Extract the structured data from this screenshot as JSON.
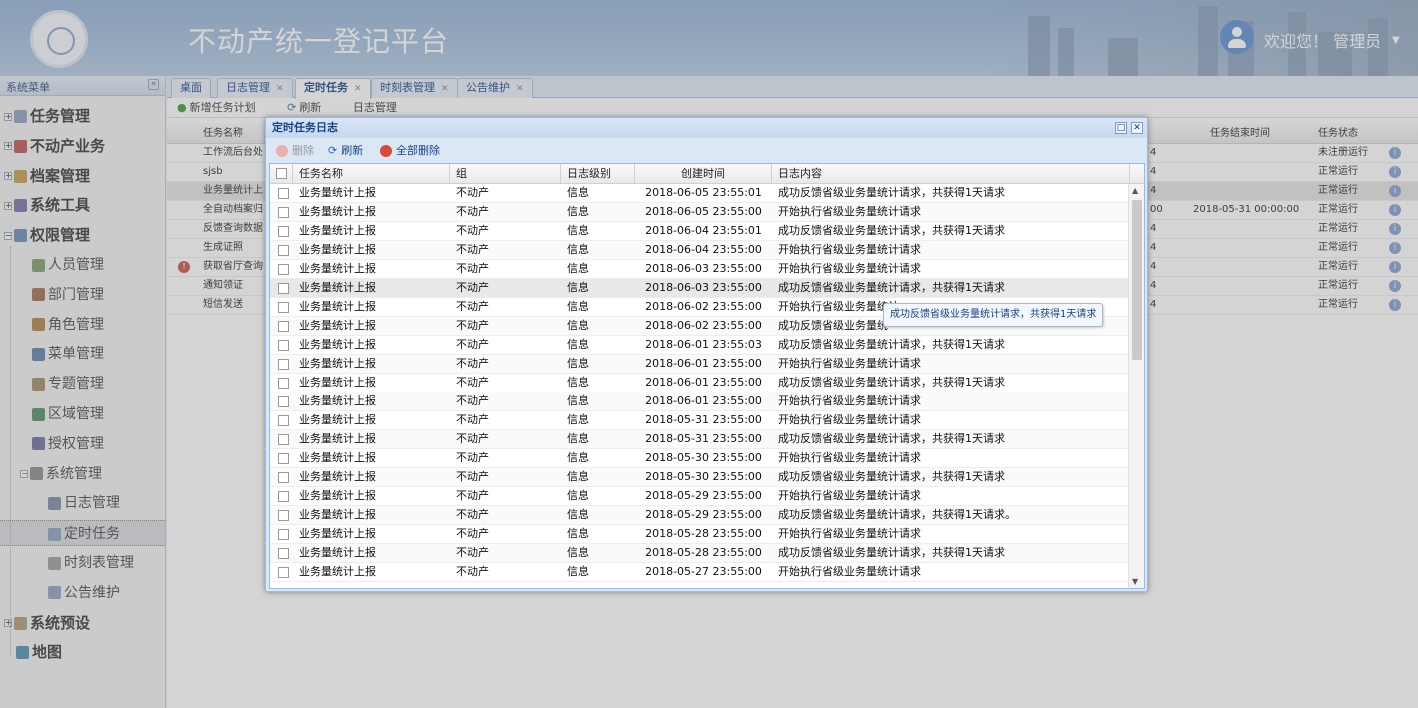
{
  "header": {
    "title": "不动产统一登记平台",
    "welcome": "欢迎您！ 管理员"
  },
  "sidebar": {
    "title": "系统菜单",
    "items": [
      {
        "label": "任务管理",
        "level": 1,
        "expand": "+"
      },
      {
        "label": "不动产业务",
        "level": 1,
        "expand": "+"
      },
      {
        "label": "档案管理",
        "level": 1,
        "expand": "+"
      },
      {
        "label": "系统工具",
        "level": 1,
        "expand": "+"
      },
      {
        "label": "权限管理",
        "level": 1,
        "expand": "-"
      },
      {
        "label": "人员管理",
        "level": 2
      },
      {
        "label": "部门管理",
        "level": 2
      },
      {
        "label": "角色管理",
        "level": 2
      },
      {
        "label": "菜单管理",
        "level": 2
      },
      {
        "label": "专题管理",
        "level": 2
      },
      {
        "label": "区域管理",
        "level": 2
      },
      {
        "label": "授权管理",
        "level": 2
      },
      {
        "label": "系统管理",
        "level": 2,
        "expand": "-"
      },
      {
        "label": "日志管理",
        "level": 3
      },
      {
        "label": "定时任务",
        "level": 3,
        "selected": true
      },
      {
        "label": "时刻表管理",
        "level": 3
      },
      {
        "label": "公告维护",
        "level": 3
      },
      {
        "label": "系统预设",
        "level": 1,
        "expand": "+"
      },
      {
        "label": "地图",
        "level": 1
      }
    ]
  },
  "tabs": [
    {
      "label": "桌面",
      "closable": false
    },
    {
      "label": "日志管理",
      "closable": true
    },
    {
      "label": "定时任务",
      "closable": true,
      "active": true
    },
    {
      "label": "时刻表管理",
      "closable": true
    },
    {
      "label": "公告维护",
      "closable": true
    }
  ],
  "main_toolbar": {
    "add": "新增任务计划",
    "refresh": "刷新",
    "log": "日志管理"
  },
  "bg_table": {
    "headers": {
      "name": "任务名称",
      "end": "任务结束时间",
      "status": "任务状态"
    },
    "rows": [
      {
        "name": "工作流后台处",
        "time": "4",
        "end": "",
        "status": "未注册运行"
      },
      {
        "name": "sjsb",
        "time": "4",
        "end": "",
        "status": "正常运行"
      },
      {
        "name": "业务量统计上",
        "time": "4",
        "end": "",
        "status": "正常运行"
      },
      {
        "name": "全自动档案归",
        "time": "00",
        "end": "2018-05-31 00:00:00",
        "status": "正常运行"
      },
      {
        "name": "反馈查询数据",
        "time": "4",
        "end": "",
        "status": "正常运行"
      },
      {
        "name": "生成证照",
        "time": "4",
        "end": "",
        "status": "正常运行"
      },
      {
        "name": "获取省厅查询",
        "time": "4",
        "end": "",
        "status": "正常运行"
      },
      {
        "name": "通知领证",
        "time": "4",
        "end": "",
        "status": "正常运行"
      },
      {
        "name": "短信发送",
        "time": "4",
        "end": "",
        "status": "正常运行"
      }
    ]
  },
  "dialog": {
    "title": "定时任务日志",
    "toolbar": {
      "delete": "删除",
      "refresh": "刷新",
      "delete_all": "全部删除"
    },
    "columns": {
      "name": "任务名称",
      "group": "组",
      "level": "日志级别",
      "created": "创建时间",
      "content": "日志内容"
    },
    "rows": [
      {
        "name": "业务量统计上报",
        "group": "不动产",
        "level": "信息",
        "created": "2018-06-05 23:55:01",
        "content": "成功反馈省级业务量统计请求，共获得1天请求"
      },
      {
        "name": "业务量统计上报",
        "group": "不动产",
        "level": "信息",
        "created": "2018-06-05 23:55:00",
        "content": "开始执行省级业务量统计请求"
      },
      {
        "name": "业务量统计上报",
        "group": "不动产",
        "level": "信息",
        "created": "2018-06-04 23:55:01",
        "content": "成功反馈省级业务量统计请求，共获得1天请求"
      },
      {
        "name": "业务量统计上报",
        "group": "不动产",
        "level": "信息",
        "created": "2018-06-04 23:55:00",
        "content": "开始执行省级业务量统计请求"
      },
      {
        "name": "业务量统计上报",
        "group": "不动产",
        "level": "信息",
        "created": "2018-06-03 23:55:00",
        "content": "开始执行省级业务量统计请求"
      },
      {
        "name": "业务量统计上报",
        "group": "不动产",
        "level": "信息",
        "created": "2018-06-03 23:55:00",
        "content": "成功反馈省级业务量统计请求，共获得1天请求"
      },
      {
        "name": "业务量统计上报",
        "group": "不动产",
        "level": "信息",
        "created": "2018-06-02 23:55:00",
        "content": "开始执行省级业务量统计"
      },
      {
        "name": "业务量统计上报",
        "group": "不动产",
        "level": "信息",
        "created": "2018-06-02 23:55:00",
        "content": "成功反馈省级业务量统"
      },
      {
        "name": "业务量统计上报",
        "group": "不动产",
        "level": "信息",
        "created": "2018-06-01 23:55:03",
        "content": "成功反馈省级业务量统计请求，共获得1天请求"
      },
      {
        "name": "业务量统计上报",
        "group": "不动产",
        "level": "信息",
        "created": "2018-06-01 23:55:00",
        "content": "开始执行省级业务量统计请求"
      },
      {
        "name": "业务量统计上报",
        "group": "不动产",
        "level": "信息",
        "created": "2018-06-01 23:55:00",
        "content": "成功反馈省级业务量统计请求，共获得1天请求"
      },
      {
        "name": "业务量统计上报",
        "group": "不动产",
        "level": "信息",
        "created": "2018-06-01 23:55:00",
        "content": "开始执行省级业务量统计请求"
      },
      {
        "name": "业务量统计上报",
        "group": "不动产",
        "level": "信息",
        "created": "2018-05-31 23:55:00",
        "content": "开始执行省级业务量统计请求"
      },
      {
        "name": "业务量统计上报",
        "group": "不动产",
        "level": "信息",
        "created": "2018-05-31 23:55:00",
        "content": "成功反馈省级业务量统计请求，共获得1天请求"
      },
      {
        "name": "业务量统计上报",
        "group": "不动产",
        "level": "信息",
        "created": "2018-05-30 23:55:00",
        "content": "开始执行省级业务量统计请求"
      },
      {
        "name": "业务量统计上报",
        "group": "不动产",
        "level": "信息",
        "created": "2018-05-30 23:55:00",
        "content": "成功反馈省级业务量统计请求，共获得1天请求"
      },
      {
        "name": "业务量统计上报",
        "group": "不动产",
        "level": "信息",
        "created": "2018-05-29 23:55:00",
        "content": "开始执行省级业务量统计请求"
      },
      {
        "name": "业务量统计上报",
        "group": "不动产",
        "level": "信息",
        "created": "2018-05-29 23:55:00",
        "content": "成功反馈省级业务量统计请求，共获得1天请求。"
      },
      {
        "name": "业务量统计上报",
        "group": "不动产",
        "level": "信息",
        "created": "2018-05-28 23:55:00",
        "content": "开始执行省级业务量统计请求"
      },
      {
        "name": "业务量统计上报",
        "group": "不动产",
        "level": "信息",
        "created": "2018-05-28 23:55:00",
        "content": "成功反馈省级业务量统计请求，共获得1天请求"
      },
      {
        "name": "业务量统计上报",
        "group": "不动产",
        "level": "信息",
        "created": "2018-05-27 23:55:00",
        "content": "开始执行省级业务量统计请求"
      }
    ],
    "tooltip": "成功反馈省级业务量统计请求，共获得1天请求"
  }
}
